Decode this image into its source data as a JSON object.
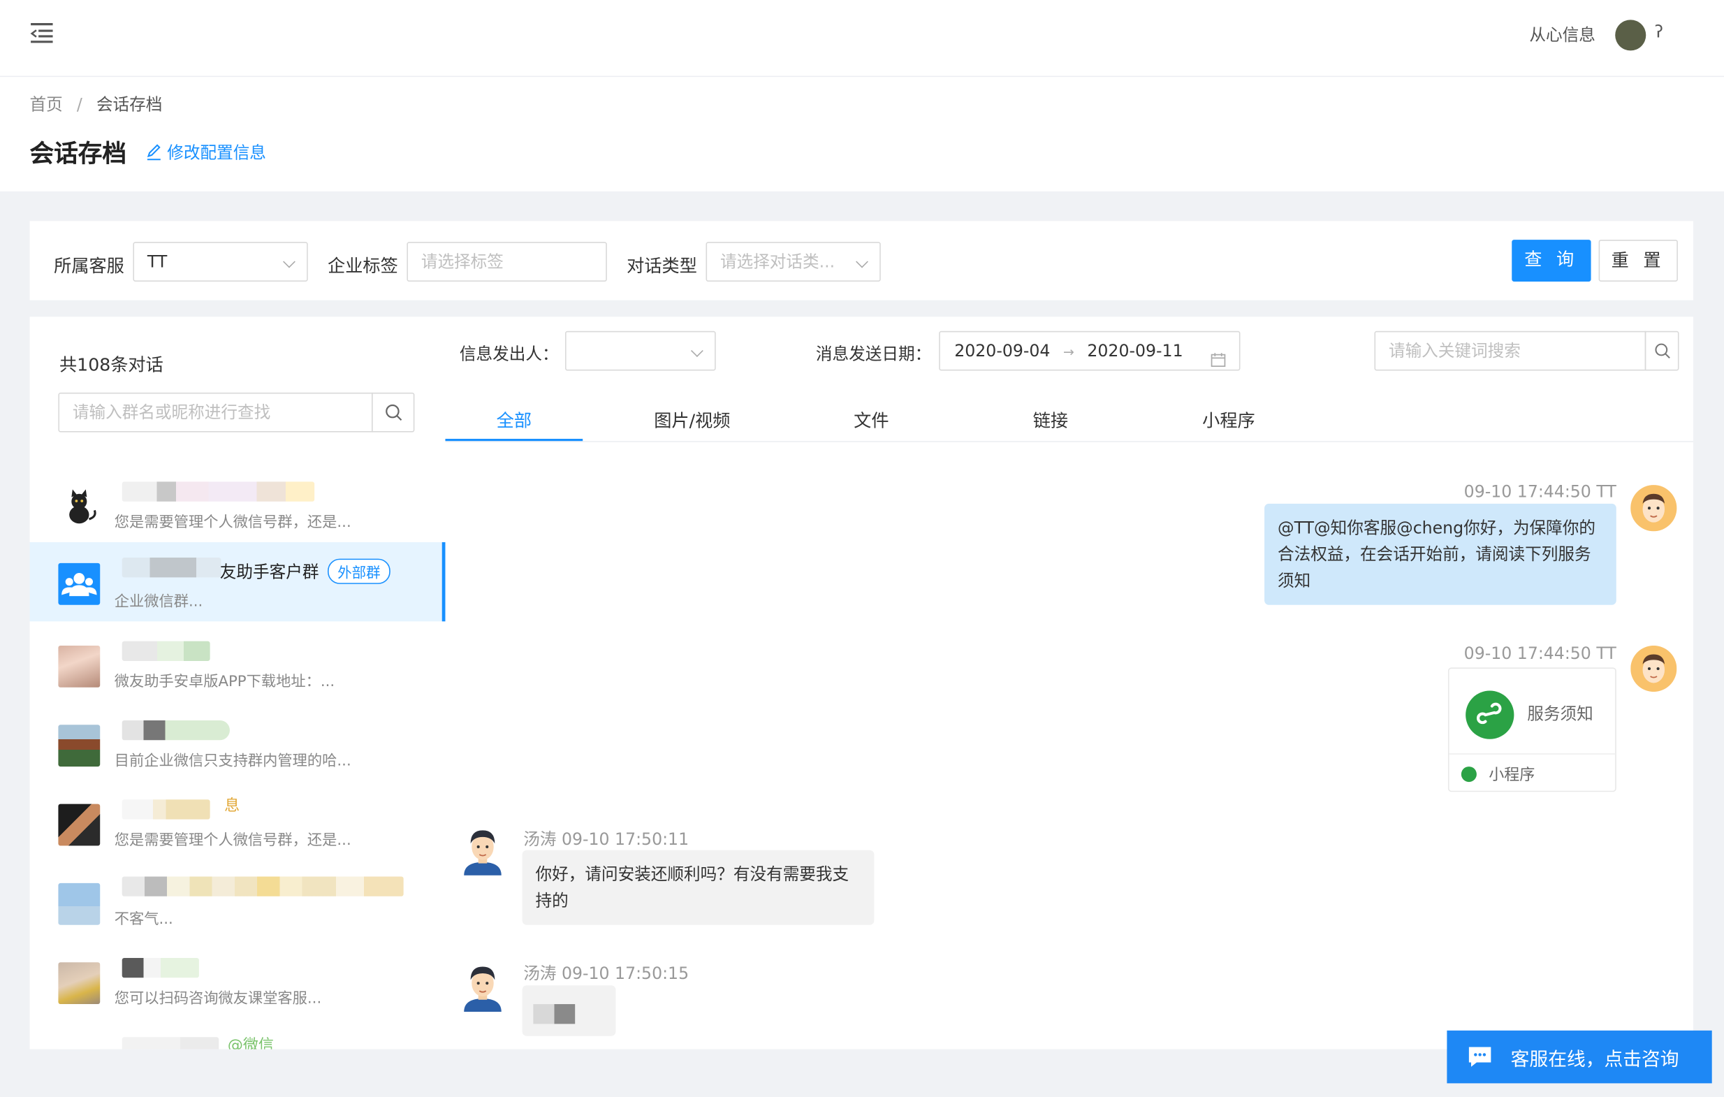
{
  "topbar": {
    "company": "从心信息",
    "user_initial": "ʔ"
  },
  "breadcrumb": {
    "home": "首页",
    "sep": "/",
    "current": "会话存档"
  },
  "page": {
    "title": "会话存档",
    "edit_link": "修改配置信息"
  },
  "filters": {
    "service_label": "所属客服",
    "service_value": "TT",
    "tag_label": "企业标签",
    "tag_placeholder": "请选择标签",
    "type_label": "对话类型",
    "type_placeholder": "请选择对话类...",
    "search_button": "查 询",
    "reset_button": "重 置"
  },
  "conversations": {
    "count_text": "共108条对话",
    "search_placeholder": "请输入群名或昵称进行查找",
    "items": [
      {
        "name": "",
        "preview": "您是需要管理个人微信号群，还是..."
      },
      {
        "name": "友助手客户群",
        "badge": "外部群",
        "preview": "企业微信群..."
      },
      {
        "name": "",
        "preview": "微友助手安卓版APP下载地址：..."
      },
      {
        "name": "",
        "preview": "目前企业微信只支持群内管理的哈..."
      },
      {
        "name": "息",
        "preview": "您是需要管理个人微信号群，还是..."
      },
      {
        "name": "",
        "preview": "不客气..."
      },
      {
        "name": "",
        "preview": "您可以扫码咨询微友课堂客服..."
      },
      {
        "name": "@微信",
        "preview": ""
      }
    ]
  },
  "messages_filter": {
    "sender_label": "信息发出人：",
    "date_label": "消息发送日期：",
    "date_start": "2020-09-04",
    "date_arrow": "→",
    "date_end": "2020-09-11",
    "keyword_placeholder": "请输入关键词搜索"
  },
  "tabs": [
    "全部",
    "图片/视频",
    "文件",
    "链接",
    "小程序"
  ],
  "messages": [
    {
      "time": "09-10 17:44:50 TT",
      "text": "@TT@知你客服@cheng你好，为保障你的合法权益，在会话开始前，请阅读下列服务须知"
    },
    {
      "time": "09-10 17:44:50 TT",
      "card_title": "服务须知",
      "card_type": "小程序"
    },
    {
      "time": "汤涛 09-10 17:50:11",
      "text": "你好，请问安装还顺利吗？有没有需要我支持的"
    },
    {
      "time": "汤涛 09-10 17:50:15"
    }
  ],
  "support": {
    "text": "客服在线，点击咨询"
  },
  "colors": {
    "primary": "#1890ff",
    "selected_bg": "#e6f4ff",
    "sent_bubble": "#cfe8fb",
    "recv_bubble": "#f2f2f2",
    "support_bg": "#1e88f5",
    "miniprogram_green": "#2ba245"
  }
}
